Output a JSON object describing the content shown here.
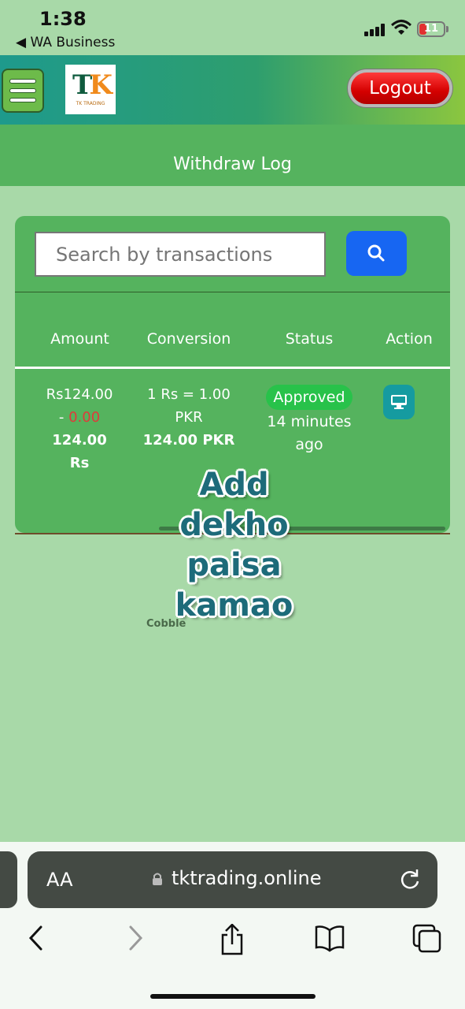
{
  "status_bar": {
    "time": "1:38",
    "back_app": "◀ WA Business",
    "battery": "11"
  },
  "navbar": {
    "logo_t": "T",
    "logo_k": "K",
    "logo_subtitle": "TK TRADING",
    "logout_label": "Logout"
  },
  "page": {
    "title": "Withdraw Log"
  },
  "search": {
    "placeholder": "Search by transactions"
  },
  "table": {
    "headers": [
      "Amount",
      "Conversion",
      "Status",
      "Action"
    ],
    "rows": [
      {
        "amount": "Rs124.00",
        "charge_prefix": "- ",
        "charge": "0.00",
        "net_amount": "124.00",
        "currency": "Rs",
        "conversion": "1 Rs = 1.00",
        "conversion_unit": "PKR",
        "converted": "124.00 PKR",
        "status": "Approved",
        "time_ago_1": "14 minutes",
        "time_ago_2": "ago",
        "action_icon": "monitor-icon"
      }
    ]
  },
  "sticker": {
    "lines": [
      "Add",
      "dekho",
      "paisa",
      "kamao"
    ],
    "mark": "Cobble"
  },
  "browser": {
    "text_size_label": "AA",
    "url": "tktrading.online"
  },
  "colors": {
    "background": "#a8d9a8",
    "card": "#55b35e",
    "logout": "#d40000",
    "search_button": "#1766f2",
    "approved": "#28c24a",
    "action": "#159ba0"
  }
}
